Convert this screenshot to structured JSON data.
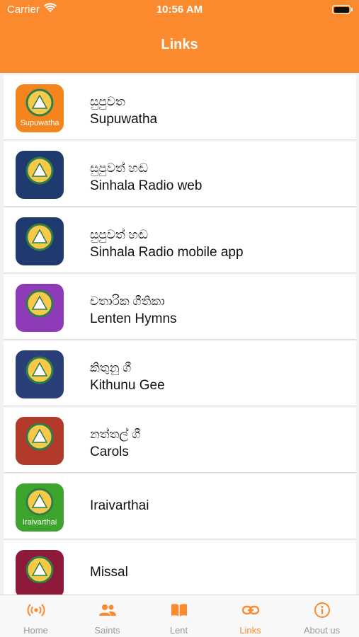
{
  "status_bar": {
    "carrier": "Carrier",
    "time": "10:56 AM"
  },
  "header": {
    "title": "Links"
  },
  "links": [
    {
      "line1": "සුපුවත",
      "line2": "Supuwatha",
      "icon_name": "supuwatha-app-icon",
      "icon_text": "Supuwatha",
      "bg": "#f4851e"
    },
    {
      "line1": "සුපුවත් හඬ",
      "line2": "Sinhala Radio web",
      "icon_name": "radio-web-app-icon",
      "icon_text": "",
      "bg": "#1e3a6e"
    },
    {
      "line1": "සුපුවත් හඬ",
      "line2": "Sinhala Radio mobile app",
      "icon_name": "radio-mobile-app-icon",
      "icon_text": "",
      "bg": "#1e3a6e"
    },
    {
      "line1": "චතාරික ගීතිකා",
      "line2": "Lenten Hymns",
      "icon_name": "lenten-hymns-app-icon",
      "icon_text": "",
      "bg": "#8e3bb8"
    },
    {
      "line1": "කිතුනු ගී",
      "line2": "Kithunu Gee",
      "icon_name": "kithunu-gee-app-icon",
      "icon_text": "",
      "bg": "#2a3f78"
    },
    {
      "line1": "නත්තල් ගී",
      "line2": "Carols",
      "icon_name": "carols-app-icon",
      "icon_text": "",
      "bg": "#b23a2a"
    },
    {
      "line1": "",
      "line2": "Iraivarthai",
      "icon_name": "iraivarthai-app-icon",
      "icon_text": "Iraivarthai",
      "bg": "#3ea42e"
    },
    {
      "line1": "",
      "line2": "Missal",
      "icon_name": "missal-app-icon",
      "icon_text": "",
      "bg": "#8e1a3a"
    }
  ],
  "tabs": [
    {
      "label": "Home",
      "icon": "radio-waves-icon"
    },
    {
      "label": "Saints",
      "icon": "people-icon"
    },
    {
      "label": "Lent",
      "icon": "open-book-icon"
    },
    {
      "label": "Links",
      "icon": "link-icon",
      "active": true
    },
    {
      "label": "About us",
      "icon": "info-icon"
    }
  ],
  "colors": {
    "accent": "#fb8a2e",
    "inactive": "#9a9a9a"
  }
}
